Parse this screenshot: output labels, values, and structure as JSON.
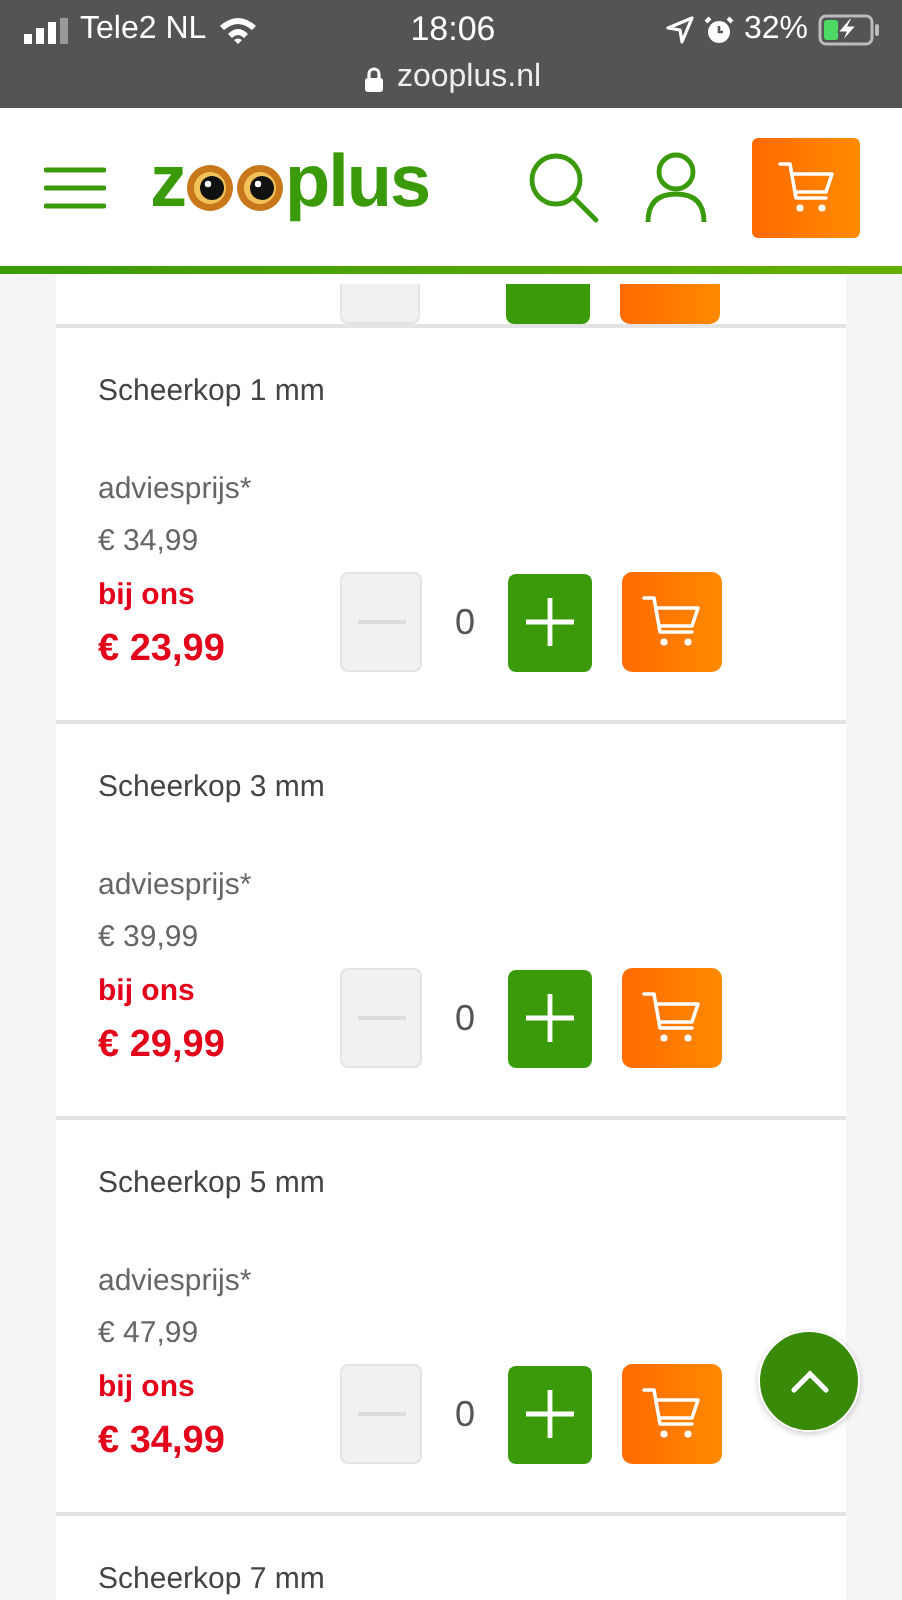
{
  "status_bar": {
    "carrier": "Tele2 NL",
    "time": "18:06",
    "battery": "32%",
    "charging": true,
    "url": "zooplus.nl"
  },
  "header": {
    "logo_start": "z",
    "logo_end": "plus"
  },
  "products": [
    {
      "kind": "cut_top"
    },
    {
      "kind": "product",
      "title": "Scheerkop 1 mm",
      "list_label": "adviesprijs*",
      "list_price": "€ 34,99",
      "our_label": "bij ons",
      "our_price": "€ 23,99",
      "quantity": "0",
      "minus_disabled": true
    },
    {
      "kind": "product",
      "title": "Scheerkop 3 mm",
      "list_label": "adviesprijs*",
      "list_price": "€ 39,99",
      "our_label": "bij ons",
      "our_price": "€ 29,99",
      "quantity": "0",
      "minus_disabled": true
    },
    {
      "kind": "product",
      "title": "Scheerkop 5 mm",
      "list_label": "adviesprijs*",
      "list_price": "€ 47,99",
      "our_label": "bij ons",
      "our_price": "€ 34,99",
      "quantity": "0",
      "minus_disabled": true
    },
    {
      "kind": "cut_bottom",
      "title": "Scheerkop 7 mm"
    }
  ],
  "scroll_top": true
}
